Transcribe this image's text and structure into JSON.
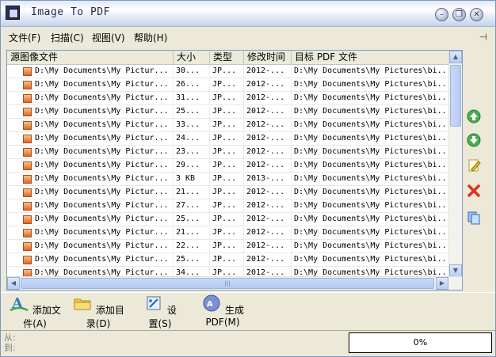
{
  "window": {
    "title": "Image To PDF"
  },
  "menu": {
    "items": [
      "文件(F)",
      "扫描(C)",
      "视图(V)",
      "帮助(H)"
    ],
    "pin_icon": "pin-icon"
  },
  "table": {
    "columns": [
      "源图像文件",
      "大小",
      "类型",
      "修改时间",
      "目标 PDF 文件"
    ],
    "rows": [
      [
        "D:\\My Documents\\My Pictur...",
        "30...",
        "JP...",
        "2012-...",
        "D:\\My Documents\\My Pictures\\bi..."
      ],
      [
        "D:\\My Documents\\My Pictur...",
        "26...",
        "JP...",
        "2012-...",
        "D:\\My Documents\\My Pictures\\bi..."
      ],
      [
        "D:\\My Documents\\My Pictur...",
        "31...",
        "JP...",
        "2012-...",
        "D:\\My Documents\\My Pictures\\bi..."
      ],
      [
        "D:\\My Documents\\My Pictur...",
        "25...",
        "JP...",
        "2012-...",
        "D:\\My Documents\\My Pictures\\bi..."
      ],
      [
        "D:\\My Documents\\My Pictur...",
        "33...",
        "JP...",
        "2012-...",
        "D:\\My Documents\\My Pictures\\bi..."
      ],
      [
        "D:\\My Documents\\My Pictur...",
        "24...",
        "JP...",
        "2012-...",
        "D:\\My Documents\\My Pictures\\bi..."
      ],
      [
        "D:\\My Documents\\My Pictur...",
        "23...",
        "JP...",
        "2012-...",
        "D:\\My Documents\\My Pictures\\bi..."
      ],
      [
        "D:\\My Documents\\My Pictur...",
        "29...",
        "JP...",
        "2012-...",
        "D:\\My Documents\\My Pictures\\bi..."
      ],
      [
        "D:\\My Documents\\My Pictur...",
        "3 KB",
        "JP...",
        "2013-...",
        "D:\\My Documents\\My Pictures\\bi..."
      ],
      [
        "D:\\My Documents\\My Pictur...",
        "21...",
        "JP...",
        "2012-...",
        "D:\\My Documents\\My Pictures\\bi..."
      ],
      [
        "D:\\My Documents\\My Pictur...",
        "27...",
        "JP...",
        "2012-...",
        "D:\\My Documents\\My Pictures\\bi..."
      ],
      [
        "D:\\My Documents\\My Pictur...",
        "25...",
        "JP...",
        "2012-...",
        "D:\\My Documents\\My Pictures\\bi..."
      ],
      [
        "D:\\My Documents\\My Pictur...",
        "21...",
        "JP...",
        "2012-...",
        "D:\\My Documents\\My Pictures\\bi..."
      ],
      [
        "D:\\My Documents\\My Pictur...",
        "22...",
        "JP...",
        "2012-...",
        "D:\\My Documents\\My Pictures\\bi..."
      ],
      [
        "D:\\My Documents\\My Pictur...",
        "25...",
        "JP...",
        "2012-...",
        "D:\\My Documents\\My Pictures\\bi..."
      ],
      [
        "D:\\My Documents\\My Pictur...",
        "34...",
        "JP...",
        "2012-...",
        "D:\\My Documents\\My Pictures\\bi..."
      ]
    ]
  },
  "side_tools": [
    "move-up-icon",
    "move-down-icon",
    "edit-icon",
    "delete-icon",
    "copy-icon"
  ],
  "toolbar": {
    "add_file": "添加文件(A)",
    "add_dir": "添加目录(D)",
    "settings": "设置(S)",
    "generate": "生成 PDF(M)"
  },
  "status": {
    "from_label": "从:",
    "to_label": "到:",
    "progress_text": "0%",
    "progress_value": 0
  },
  "colors": {
    "title_text": "#1d2a55",
    "accent_green": "#4caf50",
    "delete_red": "#e0301e"
  }
}
